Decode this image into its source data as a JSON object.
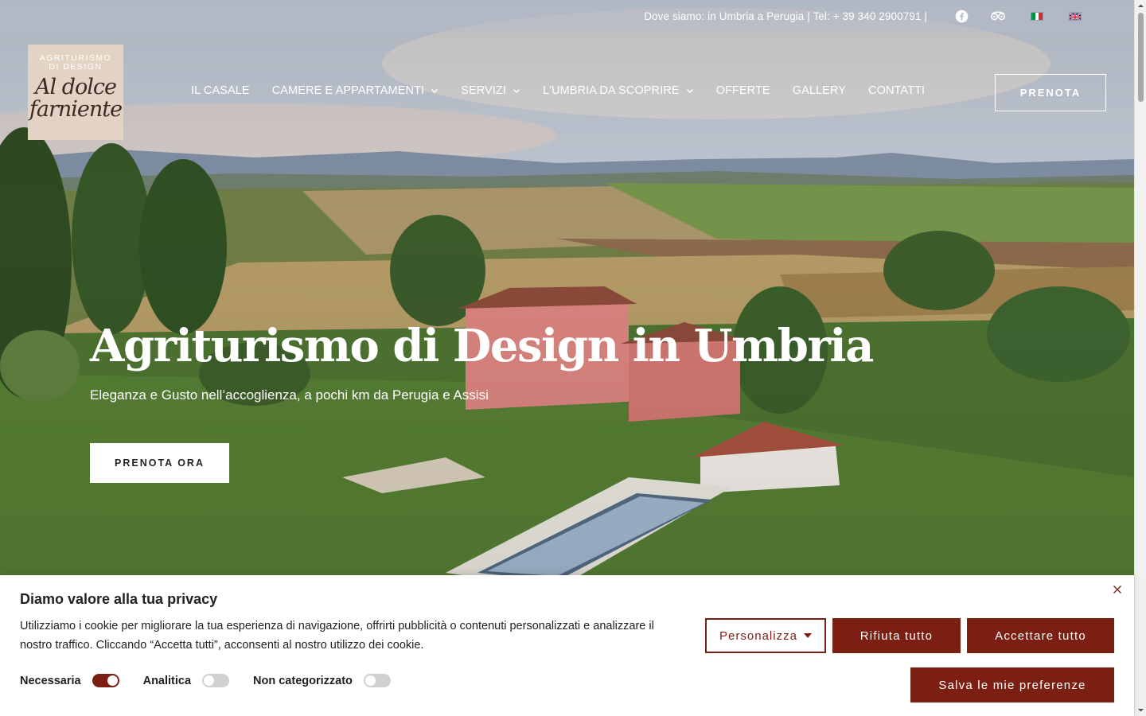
{
  "topbar": {
    "info": "Dove siamo: in Umbria a Perugia | Tel: + 39 340 2900791 |",
    "icons": [
      "facebook-icon",
      "tripadvisor-icon"
    ],
    "languages": [
      "it",
      "en"
    ]
  },
  "logo": {
    "line1": "AGRITURISMO",
    "line2": "DI DESIGN",
    "script1": "Al dolce",
    "script2": "farniente"
  },
  "nav": {
    "items": [
      {
        "label": "IL CASALE",
        "dropdown": false
      },
      {
        "label": "CAMERE E APPARTAMENTI",
        "dropdown": true
      },
      {
        "label": "SERVIZI",
        "dropdown": true
      },
      {
        "label": "L'UMBRIA DA SCOPRIRE",
        "dropdown": true
      },
      {
        "label": "OFFERTE",
        "dropdown": false
      },
      {
        "label": "GALLERY",
        "dropdown": false
      },
      {
        "label": "CONTATTI",
        "dropdown": false
      }
    ],
    "cta": "PRENOTA"
  },
  "hero": {
    "title": "Agriturismo di Design in Umbria",
    "subtitle": "Eleganza e Gusto nell’accoglienza, a pochi km da Perugia e Assisi",
    "cta": "PRENOTA ORA"
  },
  "cookie": {
    "title": "Diamo valore alla tua privacy",
    "text": "Utilizziamo i cookie per migliorare la tua esperienza di navigazione, offrirti pubblicità o contenuti personalizzati e analizzare il nostro traffico. Cliccando “Accetta tutti”, acconsenti al nostro utilizzo dei cookie.",
    "btn_customize": "Personalizza",
    "btn_reject": "Rifiuta tutto",
    "btn_accept": "Accettare tutto",
    "btn_save": "Salva le mie preferenze",
    "toggles": [
      {
        "label": "Necessaria",
        "on": true
      },
      {
        "label": "Analitica",
        "on": false
      },
      {
        "label": "Non categorizzato",
        "on": false
      }
    ],
    "accent": "#7a1f12"
  }
}
